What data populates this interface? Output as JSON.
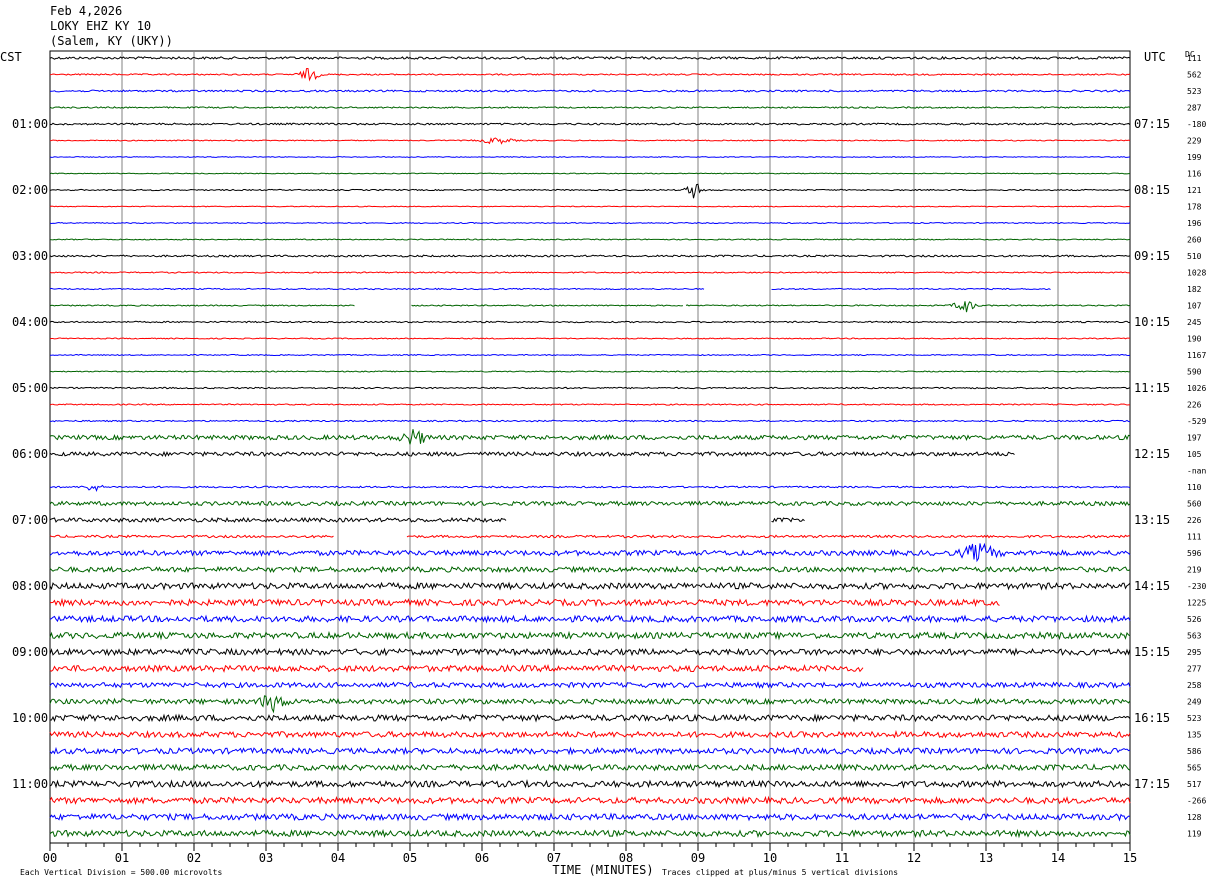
{
  "header": {
    "date": "Feb 4,2026",
    "station": "LOKY EHZ KY 10",
    "location": "(Salem, KY (UKY))"
  },
  "chart_data": {
    "type": "helicorder",
    "left_zone": "CST",
    "right_zone": "UTC",
    "dc_label": "DC",
    "xlabel": "TIME (MINUTES)",
    "x_ticks": [
      "00",
      "01",
      "02",
      "03",
      "04",
      "05",
      "06",
      "07",
      "08",
      "09",
      "10",
      "11",
      "12",
      "13",
      "14",
      "15"
    ],
    "xlim": [
      0,
      15
    ],
    "footer_left": "Each Vertical Division =   500.00 microvolts",
    "footer_right": "Traces clipped at plus/minus 5 vertical divisions",
    "colors": [
      "#000000",
      "#ff0000",
      "#0000ff",
      "#006400"
    ],
    "left_times": [
      "01:00",
      "02:00",
      "03:00",
      "04:00",
      "05:00",
      "06:00",
      "07:00",
      "08:00",
      "09:00",
      "10:00",
      "11:00"
    ],
    "right_times": [
      "07:15",
      "08:15",
      "09:15",
      "10:15",
      "11:15",
      "12:15",
      "13:15",
      "14:15",
      "15:15",
      "16:15",
      "17:15"
    ],
    "dc_values": [
      "111",
      "562",
      "523",
      "287",
      "-180",
      "229",
      "199",
      "116",
      "121",
      "178",
      "196",
      "260",
      "510",
      "1028",
      "182",
      "107",
      "245",
      "190",
      "1167",
      "590",
      "1026",
      "226",
      "-529",
      "197",
      "105",
      "-nan",
      "110",
      "560",
      "226",
      "111",
      "596",
      "219",
      "-230",
      "1225",
      "526",
      "563",
      "295",
      "277",
      "258",
      "249",
      "523",
      "135",
      "586",
      "565",
      "517",
      "-266",
      "128",
      "119"
    ],
    "rows": [
      {
        "amp": 1.2,
        "gaps": [],
        "bursts": []
      },
      {
        "amp": 0.7,
        "gaps": [],
        "bursts": [
          {
            "t": 3.6,
            "w": 0.12,
            "a": 6
          }
        ]
      },
      {
        "amp": 0.9,
        "gaps": [],
        "bursts": []
      },
      {
        "amp": 0.7,
        "gaps": [],
        "bursts": []
      },
      {
        "amp": 0.9,
        "gaps": [],
        "bursts": []
      },
      {
        "amp": 0.5,
        "gaps": [],
        "bursts": [
          {
            "t": 6.2,
            "w": 0.2,
            "a": 3
          }
        ]
      },
      {
        "amp": 0.4,
        "gaps": [],
        "bursts": []
      },
      {
        "amp": 0.4,
        "gaps": [],
        "bursts": []
      },
      {
        "amp": 0.6,
        "gaps": [],
        "bursts": [
          {
            "t": 8.95,
            "w": 0.1,
            "a": 8
          }
        ]
      },
      {
        "amp": 0.4,
        "gaps": [],
        "bursts": []
      },
      {
        "amp": 0.5,
        "gaps": [],
        "bursts": []
      },
      {
        "amp": 0.5,
        "gaps": [],
        "bursts": []
      },
      {
        "amp": 0.9,
        "gaps": [],
        "bursts": []
      },
      {
        "amp": 0.6,
        "gaps": [],
        "bursts": []
      },
      {
        "amp": 0.6,
        "gaps": [
          [
            9.1,
            10.0
          ],
          [
            13.9,
            15
          ]
        ],
        "bursts": []
      },
      {
        "amp": 0.6,
        "gaps": [
          [
            4.25,
            5.0
          ],
          [
            8.8,
            8.82
          ]
        ],
        "bursts": [
          {
            "t": 12.7,
            "w": 0.12,
            "a": 7
          }
        ]
      },
      {
        "amp": 0.7,
        "gaps": [],
        "bursts": []
      },
      {
        "amp": 0.5,
        "gaps": [],
        "bursts": []
      },
      {
        "amp": 0.5,
        "gaps": [],
        "bursts": []
      },
      {
        "amp": 0.5,
        "gaps": [],
        "bursts": []
      },
      {
        "amp": 0.7,
        "gaps": [],
        "bursts": []
      },
      {
        "amp": 0.6,
        "gaps": [],
        "bursts": []
      },
      {
        "amp": 0.7,
        "gaps": [],
        "bursts": []
      },
      {
        "amp": 2.2,
        "gaps": [],
        "bursts": [
          {
            "t": 5.05,
            "w": 0.15,
            "a": 7
          }
        ]
      },
      {
        "amp": 2.0,
        "gaps": [
          [
            13.4,
            15
          ]
        ],
        "bursts": []
      },
      {
        "amp": 0,
        "gaps": [
          [
            0,
            15
          ]
        ],
        "bursts": []
      },
      {
        "amp": 0.8,
        "gaps": [],
        "bursts": [
          {
            "t": 0.6,
            "w": 0.1,
            "a": 4
          }
        ]
      },
      {
        "amp": 2.0,
        "gaps": [],
        "bursts": []
      },
      {
        "amp": 2.0,
        "gaps": [
          [
            6.35,
            10.0
          ],
          [
            10.5,
            15
          ]
        ],
        "bursts": []
      },
      {
        "amp": 1.2,
        "gaps": [
          [
            3.95,
            4.95
          ]
        ],
        "bursts": []
      },
      {
        "amp": 2.5,
        "gaps": [],
        "bursts": [
          {
            "t": 12.9,
            "w": 0.2,
            "a": 8
          }
        ]
      },
      {
        "amp": 2.5,
        "gaps": [],
        "bursts": []
      },
      {
        "amp": 3.0,
        "gaps": [],
        "bursts": []
      },
      {
        "amp": 3.0,
        "gaps": [
          [
            13.2,
            15
          ]
        ],
        "bursts": []
      },
      {
        "amp": 3.0,
        "gaps": [],
        "bursts": []
      },
      {
        "amp": 3.0,
        "gaps": [],
        "bursts": []
      },
      {
        "amp": 3.0,
        "gaps": [],
        "bursts": []
      },
      {
        "amp": 3.0,
        "gaps": [
          [
            11.3,
            15
          ]
        ],
        "bursts": []
      },
      {
        "amp": 2.5,
        "gaps": [],
        "bursts": []
      },
      {
        "amp": 2.5,
        "gaps": [],
        "bursts": [
          {
            "t": 3.1,
            "w": 0.15,
            "a": 8
          }
        ]
      },
      {
        "amp": 3.0,
        "gaps": [],
        "bursts": []
      },
      {
        "amp": 2.8,
        "gaps": [],
        "bursts": []
      },
      {
        "amp": 2.8,
        "gaps": [],
        "bursts": []
      },
      {
        "amp": 2.8,
        "gaps": [],
        "bursts": []
      },
      {
        "amp": 3.0,
        "gaps": [],
        "bursts": []
      },
      {
        "amp": 3.0,
        "gaps": [],
        "bursts": []
      },
      {
        "amp": 3.0,
        "gaps": [],
        "bursts": []
      },
      {
        "amp": 3.0,
        "gaps": [],
        "bursts": []
      }
    ]
  }
}
